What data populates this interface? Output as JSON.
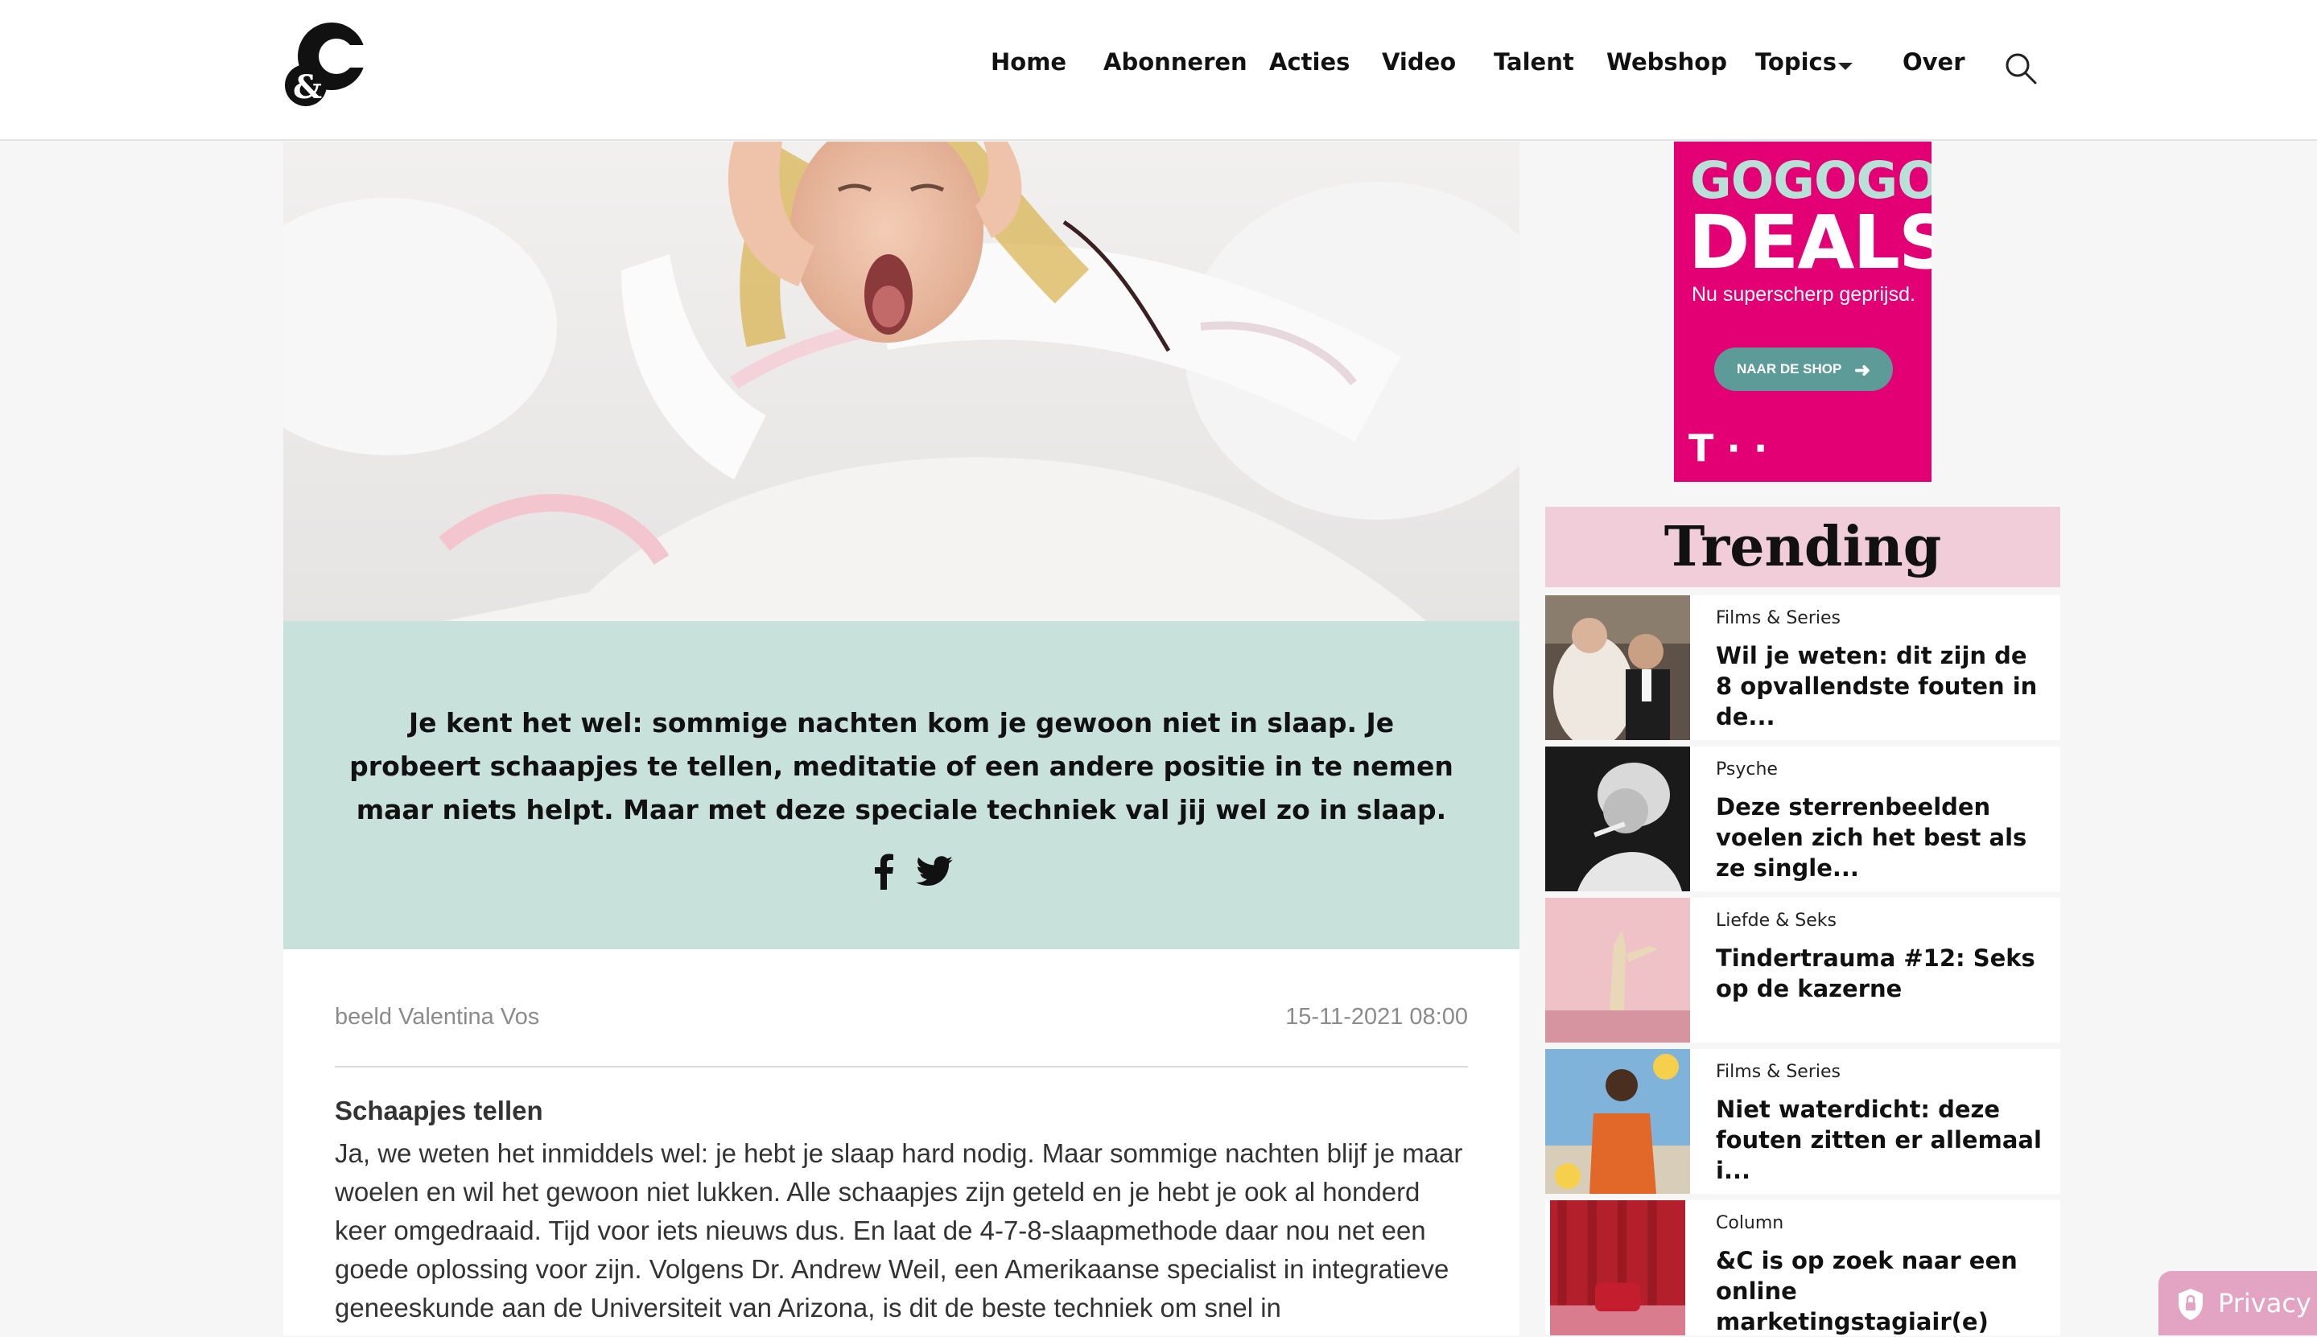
{
  "header": {
    "logo_name": "&C",
    "nav": [
      {
        "label": "Home"
      },
      {
        "label": "Abonneren"
      },
      {
        "label": "Acties"
      },
      {
        "label": "Video"
      },
      {
        "label": "Talent"
      },
      {
        "label": "Webshop"
      },
      {
        "label": "Topics",
        "has_dropdown": true
      },
      {
        "label": "Over"
      }
    ]
  },
  "article": {
    "intro": "Je kent het wel: sommige nachten kom je gewoon niet in slaap. Je probeert schaapjes te tellen, meditatie of een andere positie in te nemen maar niets helpt. Maar met deze speciale techniek val jij wel zo in slaap.",
    "credit": "beeld Valentina Vos",
    "date": "15-11-2021 08:00",
    "subheading": "Schaapjes tellen",
    "body": "Ja, we weten het inmiddels wel: je hebt je slaap hard nodig. Maar sommige nachten blijf je maar woelen en wil het gewoon niet lukken. Alle schaapjes zijn geteld en je hebt je ook al honderd keer omgedraaid. Tijd voor iets nieuws dus. En laat de 4-7-8-slaapmethode daar nou net een goede oplossing voor zijn. Volgens Dr. Andrew Weil, een Amerikaanse specialist in integratieve geneeskunde aan de Universiteit van Arizona, is dit de beste techniek om snel in"
  },
  "ad": {
    "line1": "GOGOGO",
    "line2": "DEALS",
    "sub": "Nu superscherp geprijsd.",
    "button": "NAAR DE SHOP",
    "brand": "T · ·",
    "colors": {
      "bg": "#e20074",
      "button": "#5c9b98",
      "accent": "#b7e1d7"
    }
  },
  "trending": {
    "title": "Trending",
    "items": [
      {
        "category": "Films & Series",
        "title": "Wil je weten: dit zijn de 8 opvallendste fouten in de..."
      },
      {
        "category": "Psyche",
        "title": "Deze sterrenbeelden voelen zich het best als ze single..."
      },
      {
        "category": "Liefde & Seks",
        "title": "Tindertrauma #12: Seks op de kazerne"
      },
      {
        "category": "Films & Series",
        "title": "Niet waterdicht: deze fouten zitten er allemaal i..."
      },
      {
        "category": "Column",
        "title": "&C is op zoek naar een online marketingstagiair(e)"
      }
    ]
  },
  "privacy": {
    "label": "Privacy"
  },
  "colors": {
    "intro_bg": "#c8e2db",
    "trending_bg": "#f0cdd9",
    "privacy_bg": "#e3a4c3"
  }
}
